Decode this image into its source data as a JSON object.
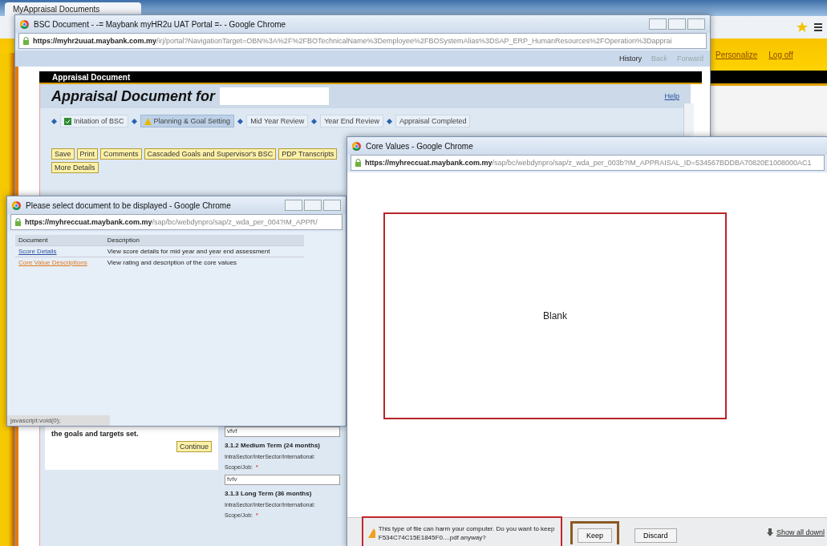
{
  "outer_browser": {
    "tab": "MyAppraisal Documents",
    "links": [
      "Personalize",
      "Log off"
    ]
  },
  "bsc_window": {
    "title": "BSC Document - -= Maybank myHR2u UAT Portal =- - Google Chrome",
    "url_host": "https://myhr2uuat.maybank.com.my",
    "url_path": "/irj/portal?NavigationTarget=OBN%3A%2F%2FBOTechnicalName%3Demployee%2FBOSystemAlias%3DSAP_ERP_HumanResources%2FOperation%3Dapprai",
    "toolbar": [
      "History",
      "Back",
      "Forward"
    ],
    "panel_title": "Appraisal Document",
    "heading": "Appraisal Document for",
    "help": "Help",
    "steps": [
      {
        "label": "Initation of BSC",
        "kind": "checked",
        "selected": false
      },
      {
        "label": "Planning & Goal Setting",
        "kind": "warning",
        "selected": true
      },
      {
        "label": "Mid Year Review",
        "kind": "plain",
        "selected": false
      },
      {
        "label": "Year End Review",
        "kind": "plain",
        "selected": false
      },
      {
        "label": "Appraisal Completed",
        "kind": "plain",
        "selected": false
      }
    ],
    "buttons": [
      "Save",
      "Print",
      "Comments",
      "Cascaded Goals and Supervisor's BSC",
      "PDP Transcripts",
      "More Details"
    ],
    "notice": "the goals and targets set.",
    "continue": "Continue",
    "form": [
      {
        "kind": "value",
        "text": "vfvf"
      },
      {
        "kind": "heading",
        "text": "3.1.2 Medium Term (24 months)"
      },
      {
        "kind": "label",
        "text": "IntraSector/InterSector/International:"
      },
      {
        "kind": "label",
        "text": "Scope/Job:",
        "required": "*"
      },
      {
        "kind": "value",
        "text": "fvfv"
      },
      {
        "kind": "heading",
        "text": "3.1.3 Long Term (36 months)"
      },
      {
        "kind": "label",
        "text": "IntraSector/InterSector/International:"
      },
      {
        "kind": "label",
        "text": "Scope/Job:",
        "required": "*"
      }
    ]
  },
  "select_window": {
    "title": "Please select document to be displayed - Google Chrome",
    "url_host": "https://myhreccuat.maybank.com.my",
    "url_path": "/sap/bc/webdynpro/sap/z_wda_per_004?IM_APPR/",
    "columns": [
      "Document",
      "Description"
    ],
    "rows": [
      {
        "document": "Score Details",
        "description": "View score details for mid year and year end assessment",
        "visited": false
      },
      {
        "document": "Core Value Descriptions",
        "description": "View rating and description of the core values",
        "visited": true
      }
    ],
    "status": "javascript:void(0);"
  },
  "core_window": {
    "title": "Core Values - Google Chrome",
    "url_host": "https://myhreccuat.maybank.com.my",
    "url_path": "/sap/bc/webdynpro/sap/z_wda_per_003b?IM_APPRAISAL_ID=534567BDDBA70820E1008000AC1",
    "content": "Blank",
    "download": {
      "warning": "This type of file can harm your computer. Do you want to keep F534C74C15E1845F0....pdf anyway?",
      "buttons": [
        "Keep",
        "Discard"
      ],
      "show_all": "Show all downl"
    }
  }
}
